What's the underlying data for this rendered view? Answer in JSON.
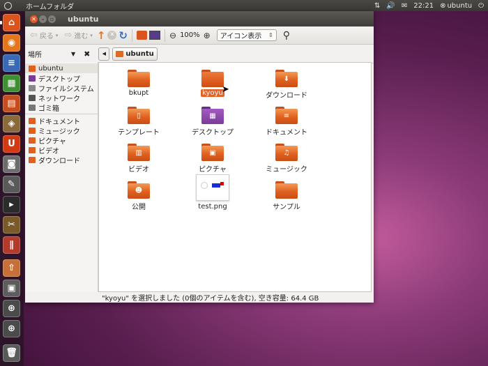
{
  "top_panel": {
    "app_title": "ホームフォルダ",
    "clock": "22:21",
    "user": "ubuntu"
  },
  "window": {
    "title": "ubuntu",
    "toolbar": {
      "back_label": "戻る",
      "forward_label": "進む",
      "zoom_level": "100%",
      "view_mode": "アイコン表示"
    },
    "location": {
      "places_label": "場所",
      "breadcrumb": "ubuntu"
    },
    "sidebar": {
      "items": [
        {
          "label": "ubuntu",
          "icon": "home-folder-icon",
          "color": "#e0601e"
        },
        {
          "label": "デスクトップ",
          "icon": "desktop-icon",
          "color": "#7a3b96"
        },
        {
          "label": "ファイルシステム",
          "icon": "drive-icon",
          "color": "#888888"
        },
        {
          "label": "ネットワーク",
          "icon": "network-icon",
          "color": "#555555"
        },
        {
          "label": "ゴミ箱",
          "icon": "trash-icon",
          "color": "#777777"
        }
      ],
      "bookmarks": [
        {
          "label": "ドキュメント",
          "icon": "documents-folder-icon",
          "color": "#e0601e"
        },
        {
          "label": "ミュージック",
          "icon": "music-folder-icon",
          "color": "#e0601e"
        },
        {
          "label": "ピクチャ",
          "icon": "pictures-folder-icon",
          "color": "#e0601e"
        },
        {
          "label": "ビデオ",
          "icon": "videos-folder-icon",
          "color": "#e0601e"
        },
        {
          "label": "ダウンロード",
          "icon": "downloads-folder-icon",
          "color": "#e0601e"
        }
      ]
    },
    "files": [
      {
        "name": "bkupt",
        "icon": "folder-icon"
      },
      {
        "name": "kyoyu",
        "icon": "folder-icon",
        "selected": true
      },
      {
        "name": "ダウンロード",
        "icon": "downloads-folder-icon"
      },
      {
        "name": "テンプレート",
        "icon": "templates-folder-icon"
      },
      {
        "name": "デスクトップ",
        "icon": "desktop-folder-icon"
      },
      {
        "name": "ドキュメント",
        "icon": "documents-folder-icon"
      },
      {
        "name": "ビデオ",
        "icon": "videos-folder-icon"
      },
      {
        "name": "ピクチャ",
        "icon": "pictures-folder-icon"
      },
      {
        "name": "ミュージック",
        "icon": "music-folder-icon"
      },
      {
        "name": "公開",
        "icon": "public-folder-icon"
      },
      {
        "name": "test.png",
        "icon": "image-file-icon"
      },
      {
        "name": "サンプル",
        "icon": "folder-icon"
      }
    ],
    "status": "\"kyoyu\" を選択しました (0個のアイテムを含む), 空き容量: 64.4 GB"
  }
}
